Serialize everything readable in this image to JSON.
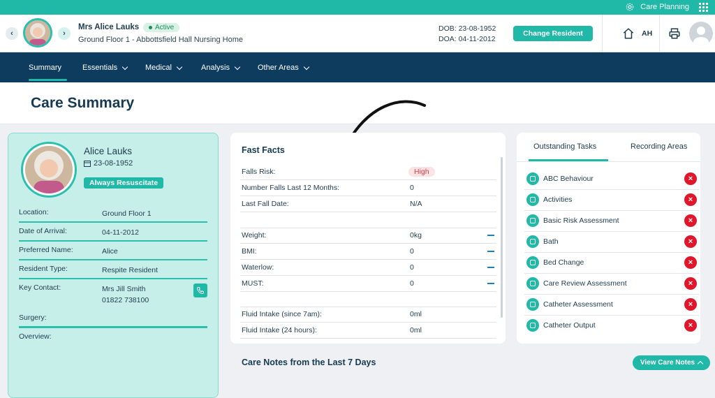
{
  "topbar": {
    "care_planning": "Care Planning"
  },
  "resident": {
    "name": "Mrs Alice Lauks",
    "status": "Active",
    "location_line": "Ground Floor 1 - Abbottsfield Hall Nursing Home",
    "dob": "DOB: 23-08-1952",
    "doa": "DOA: 04-11-2012",
    "change_button": "Change Resident"
  },
  "user": {
    "initials": "AH"
  },
  "nav": {
    "items": [
      {
        "label": "Summary"
      },
      {
        "label": "Essentials"
      },
      {
        "label": "Medical"
      },
      {
        "label": "Analysis"
      },
      {
        "label": "Other Areas"
      }
    ]
  },
  "page": {
    "title": "Care Summary"
  },
  "profile": {
    "name": "Alice Lauks",
    "dob": "23-08-1952",
    "resuscitate_badge": "Always Resuscitate",
    "rows": [
      {
        "label": "Location:",
        "value": "Ground Floor 1"
      },
      {
        "label": "Date of Arrival:",
        "value": "04-11-2012"
      },
      {
        "label": "Preferred Name:",
        "value": "Alice"
      },
      {
        "label": "Resident Type:",
        "value": "Respite Resident"
      },
      {
        "label": "Key Contact:",
        "value": "Mrs Jill Smith",
        "value2": "01822 738100"
      },
      {
        "label": "Surgery:",
        "value": ""
      },
      {
        "label": "Overview:",
        "value": ""
      }
    ]
  },
  "fast_facts": {
    "title": "Fast Facts",
    "rows": [
      {
        "label": "Falls Risk:",
        "value": "High"
      },
      {
        "label": "Number Falls Last 12 Months:",
        "value": "0"
      },
      {
        "label": "Last Fall Date:",
        "value": "N/A"
      },
      {
        "label": "Weight:",
        "value": "0kg"
      },
      {
        "label": "BMI:",
        "value": "0"
      },
      {
        "label": "Waterlow:",
        "value": "0"
      },
      {
        "label": "MUST:",
        "value": "0"
      },
      {
        "label": "Fluid Intake (since 7am):",
        "value": "0ml"
      },
      {
        "label": "Fluid Intake (24 hours):",
        "value": "0ml"
      }
    ]
  },
  "tasks": {
    "tabs": [
      {
        "label": "Outstanding Tasks"
      },
      {
        "label": "Recording Areas"
      }
    ],
    "items": [
      {
        "label": "ABC Behaviour"
      },
      {
        "label": "Activities"
      },
      {
        "label": "Basic Risk Assessment"
      },
      {
        "label": "Bath"
      },
      {
        "label": "Bed Change"
      },
      {
        "label": "Care Review Assessment"
      },
      {
        "label": "Catheter Assessment"
      },
      {
        "label": "Catheter Output"
      }
    ]
  },
  "care_notes": {
    "title": "Care Notes from the Last 7 Days",
    "view_button": "View Care Notes"
  },
  "colors": {
    "accent": "#20b8a6",
    "nav": "#0d3c5f",
    "danger": "#e0162b"
  }
}
